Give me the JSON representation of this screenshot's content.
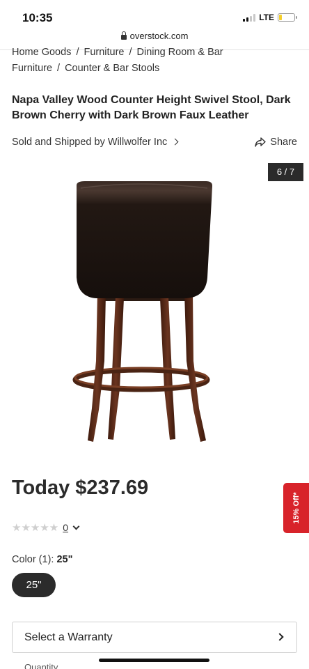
{
  "status_bar": {
    "time": "10:35",
    "network": "LTE",
    "signal_bars_active": 2,
    "signal_bars_total": 4,
    "battery_level": 0.18,
    "battery_color": "#f4cf2e"
  },
  "browser": {
    "url": "overstock.com",
    "lock_icon": "lock-icon"
  },
  "breadcrumb": {
    "items": [
      "Home Goods",
      "Furniture",
      "Dining Room & Bar Furniture",
      "Counter & Bar Stools"
    ],
    "separator": "/"
  },
  "product": {
    "title": "Napa Valley Wood Counter Height Swivel Stool, Dark Brown Cherry with Dark Brown Faux Leather",
    "sold_by_prefix": "Sold and Shipped by",
    "seller": "Willwolfer Inc",
    "share_label": "Share",
    "image_counter": "6 / 7",
    "price": "Today $237.69",
    "rating_stars": 0,
    "review_count": "0",
    "color_label": "Color (1):",
    "color_value": "25\"",
    "options": [
      "25\""
    ],
    "warranty_label": "Select a Warranty",
    "quantity_label": "Quantity"
  },
  "promo": {
    "label": "15% Off*",
    "color": "#d8232a"
  },
  "colors": {
    "text": "#2b2b2b",
    "pill_bg": "#2b2b2b",
    "stool_wood": "#5a2a17",
    "stool_leather": "#1e1512"
  }
}
